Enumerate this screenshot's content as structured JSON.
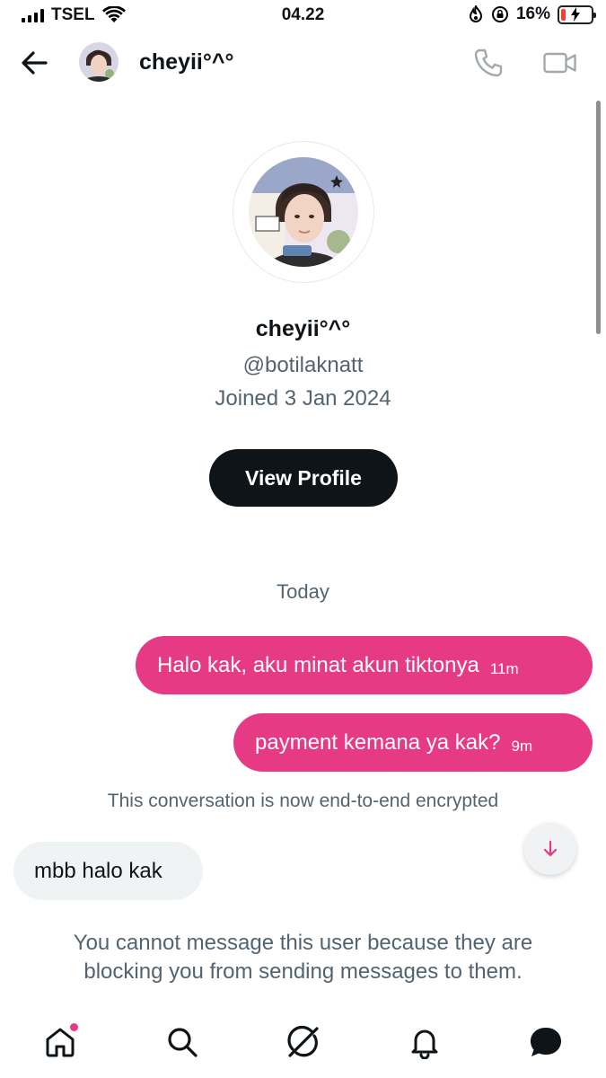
{
  "status_bar": {
    "carrier": "TSEL",
    "time": "04.22",
    "battery_percent": "16%",
    "battery_level": 0.16,
    "colors": {
      "battery_low": "#ff3b30"
    }
  },
  "header": {
    "username": "cheyii°^°",
    "back_icon": "arrow-left-icon",
    "call_icon": "phone-icon",
    "video_icon": "video-camera-icon"
  },
  "profile": {
    "display_name": "cheyii°^°",
    "handle": "@botilaknatt",
    "joined": "Joined 3 Jan 2024",
    "view_profile_label": "View Profile"
  },
  "conversation": {
    "date_label": "Today",
    "messages": [
      {
        "direction": "outgoing",
        "text": "Halo kak, aku minat akun tiktonya",
        "time": "11m"
      },
      {
        "direction": "outgoing",
        "text": "payment kemana ya kak?",
        "time": "9m"
      },
      {
        "direction": "incoming",
        "text": "mbb halo kak",
        "time": ""
      }
    ],
    "encryption_notice": "This conversation is now end-to-end encrypted",
    "blocked_notice": "You cannot message this user because they are blocking you from sending messages to them."
  },
  "tab_bar": {
    "items": [
      {
        "name": "home",
        "icon": "home-icon",
        "has_badge": true
      },
      {
        "name": "search",
        "icon": "search-icon",
        "has_badge": false
      },
      {
        "name": "grok",
        "icon": "grok-icon",
        "has_badge": false
      },
      {
        "name": "notifications",
        "icon": "bell-icon",
        "has_badge": false
      },
      {
        "name": "messages",
        "icon": "chat-bubble-icon",
        "has_badge": false
      }
    ]
  },
  "colors": {
    "accent_pink": "#e63b84",
    "text_primary": "#0f1419",
    "text_secondary": "#536471",
    "incoming_bubble": "#eff3f4"
  }
}
